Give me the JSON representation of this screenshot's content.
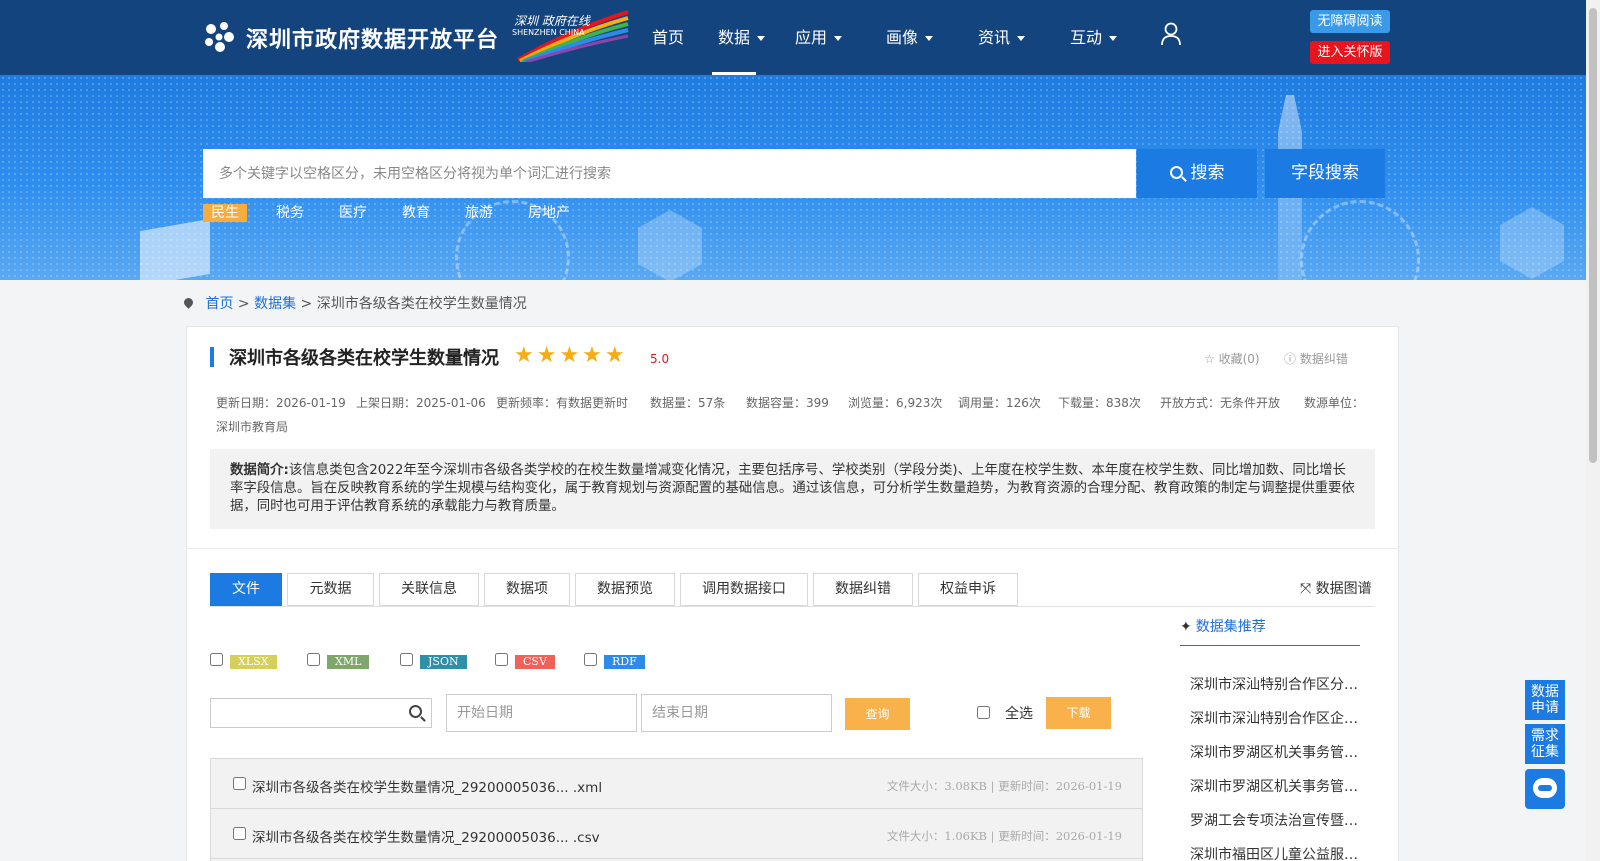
{
  "header": {
    "site_name": "深圳市政府数据开放平台",
    "city_logo_line1": "深圳 政府在线",
    "city_logo_line2": "SHENZHEN CHINA",
    "nav": [
      {
        "label": "首页",
        "has_dropdown": false
      },
      {
        "label": "数据",
        "has_dropdown": true,
        "active": true
      },
      {
        "label": "应用",
        "has_dropdown": true
      },
      {
        "label": "画像",
        "has_dropdown": true
      },
      {
        "label": "资讯",
        "has_dropdown": true
      },
      {
        "label": "互动",
        "has_dropdown": true
      }
    ],
    "accessibility_label": "无障碍阅读",
    "care_mode_label": "进入关怀版"
  },
  "search": {
    "placeholder": "多个关键字以空格区分，未用空格区分将视为单个词汇进行搜索",
    "search_label": "搜索",
    "field_search_label": "字段搜索",
    "tags": [
      "民生",
      "税务",
      "医疗",
      "教育",
      "旅游",
      "房地产"
    ],
    "active_tag": "民生"
  },
  "breadcrumb": {
    "home": "首页",
    "sep": ">",
    "section": "数据集",
    "current": "深圳市各级各类在校学生数量情况"
  },
  "dataset": {
    "title": "深圳市各级各类在校学生数量情况",
    "stars": "★★★★★",
    "rating": "5.0",
    "favorite_label": "收藏(0)",
    "correction_label": "数据纠错",
    "meta": [
      "更新日期：2026-01-19",
      "上架日期：2025-01-06",
      "更新频率：有数据更新时",
      "数据量：57条",
      "数据容量：399",
      "浏览量：6,923次",
      "调用量：126次",
      "下载量：838次",
      "开放方式：无条件开放",
      "数源单位："
    ],
    "source_unit": "深圳市教育局",
    "intro_label": "数据简介:",
    "intro_text": "该信息类包含2022年至今深圳市各级各类学校的在校生数量增减变化情况，主要包括序号、学校类别（学段分类)、上年度在校学生数、本年度在校学生数、同比增加数、同比增长率字段信息。旨在反映教育系统的学生规模与结构变化，属于教育规划与资源配置的基础信息。通过该信息，可分析学生数量趋势，为教育资源的合理分配、教育政策的制定与调整提供重要依据，同时也可用于评估教育系统的承载能力与教育质量。"
  },
  "tabs": [
    "文件",
    "元数据",
    "关联信息",
    "数据项",
    "数据预览",
    "调用数据接口",
    "数据纠错",
    "权益申诉"
  ],
  "active_tab": "文件",
  "graph_label": "数据图谱",
  "formats": [
    {
      "label": "XLSX",
      "color": "#d6d05a"
    },
    {
      "label": "XML",
      "color": "#7fa66b"
    },
    {
      "label": "JSON",
      "color": "#2e8fa8"
    },
    {
      "label": "CSV",
      "color": "#f0615a"
    },
    {
      "label": "RDF",
      "color": "#2d8be8"
    }
  ],
  "filter": {
    "keyword_value": "",
    "start_placeholder": "开始日期",
    "end_placeholder": "结束日期",
    "query_label": "查询",
    "select_all_label": "全选",
    "download_label": "下载"
  },
  "files": [
    {
      "name": "深圳市各级各类在校学生数量情况_29200005036... .xml",
      "meta": "文件大小：3.08KB | 更新时间：2026-01-19"
    },
    {
      "name": "深圳市各级各类在校学生数量情况_29200005036... .csv",
      "meta": "文件大小：1.06KB | 更新时间：2026-01-19"
    }
  ],
  "recommend": {
    "title": "数据集推荐",
    "items": [
      "深圳市深汕特别合作区分…",
      "深圳市深汕特别合作区企…",
      "深圳市罗湖区机关事务管…",
      "深圳市罗湖区机关事务管…",
      "罗湖工会专项法治宣传暨…",
      "深圳市福田区儿童公益服…"
    ]
  },
  "floating": {
    "data_request": [
      "数据",
      "申请"
    ],
    "demand_collect": [
      "需求",
      "征集"
    ]
  }
}
